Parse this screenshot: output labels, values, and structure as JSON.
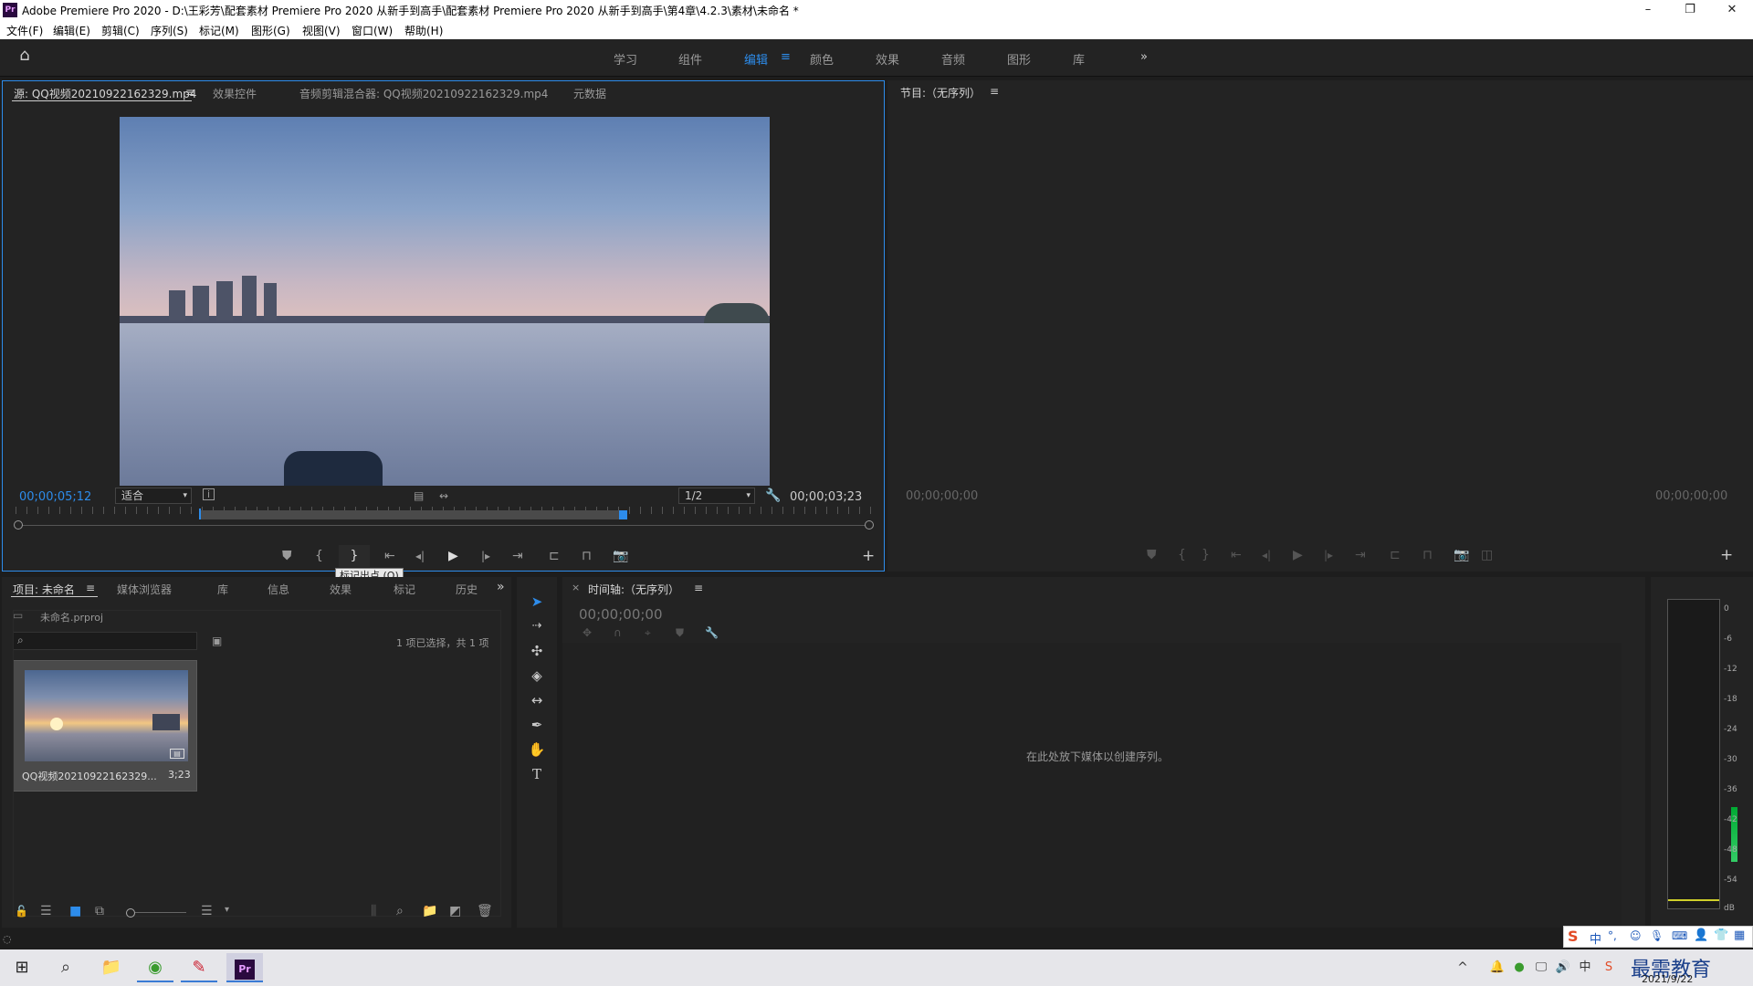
{
  "window": {
    "title": "Adobe Premiere Pro 2020 - D:\\王彩芳\\配套素材 Premiere Pro 2020 从新手到高手\\配套素材 Premiere Pro 2020 从新手到高手\\第4章\\4.2.3\\素材\\未命名 *",
    "app_icon": "Pr",
    "minimize": "–",
    "restore": "❐",
    "close": "✕"
  },
  "menu": [
    "文件(F)",
    "编辑(E)",
    "剪辑(C)",
    "序列(S)",
    "标记(M)",
    "图形(G)",
    "视图(V)",
    "窗口(W)",
    "帮助(H)"
  ],
  "workspaces": [
    "学习",
    "组件",
    "编辑",
    "颜色",
    "效果",
    "音频",
    "图形",
    "库"
  ],
  "workspace_active": "编辑",
  "workspace_more": "»",
  "source_panel": {
    "tabs": [
      "源: QQ视频20210922162329.mp4",
      "效果控件",
      "音频剪辑混合器: QQ视频20210922162329.mp4",
      "元数据"
    ],
    "timecode_in": "00;00;05;12",
    "fit": "适合",
    "resolution": "1/2",
    "duration": "00;00;03;23",
    "tooltip": "标记出点 (O)"
  },
  "program_panel": {
    "tab": "节目:（无序列）",
    "tc_left": "00;00;00;00",
    "tc_right": "00;00;00;00"
  },
  "project_panel": {
    "tabs": [
      "项目: 未命名",
      "媒体浏览器",
      "库",
      "信息",
      "效果",
      "标记",
      "历史"
    ],
    "file": "未命名.prproj",
    "selection": "1 项已选择，共 1 项",
    "clip_name": "QQ视频20210922162329...",
    "clip_duration": "3;23"
  },
  "timeline_panel": {
    "tab": "时间轴:（无序列）",
    "timecode": "00;00;00;00",
    "drop_hint": "在此处放下媒体以创建序列。"
  },
  "audio_meter": {
    "ticks": [
      "0",
      "-6",
      "-12",
      "-18",
      "-24",
      "-30",
      "-36",
      "-42",
      "-48",
      "-54",
      "dB"
    ]
  },
  "taskbar": {
    "date": "2021/9/22",
    "ime": [
      "中",
      "°,",
      "☺",
      "🎙",
      "⌨"
    ],
    "brand": "最需教育"
  },
  "colors": {
    "accent": "#2d8ceb",
    "panel": "#232323",
    "bg": "#1d1d1d"
  }
}
